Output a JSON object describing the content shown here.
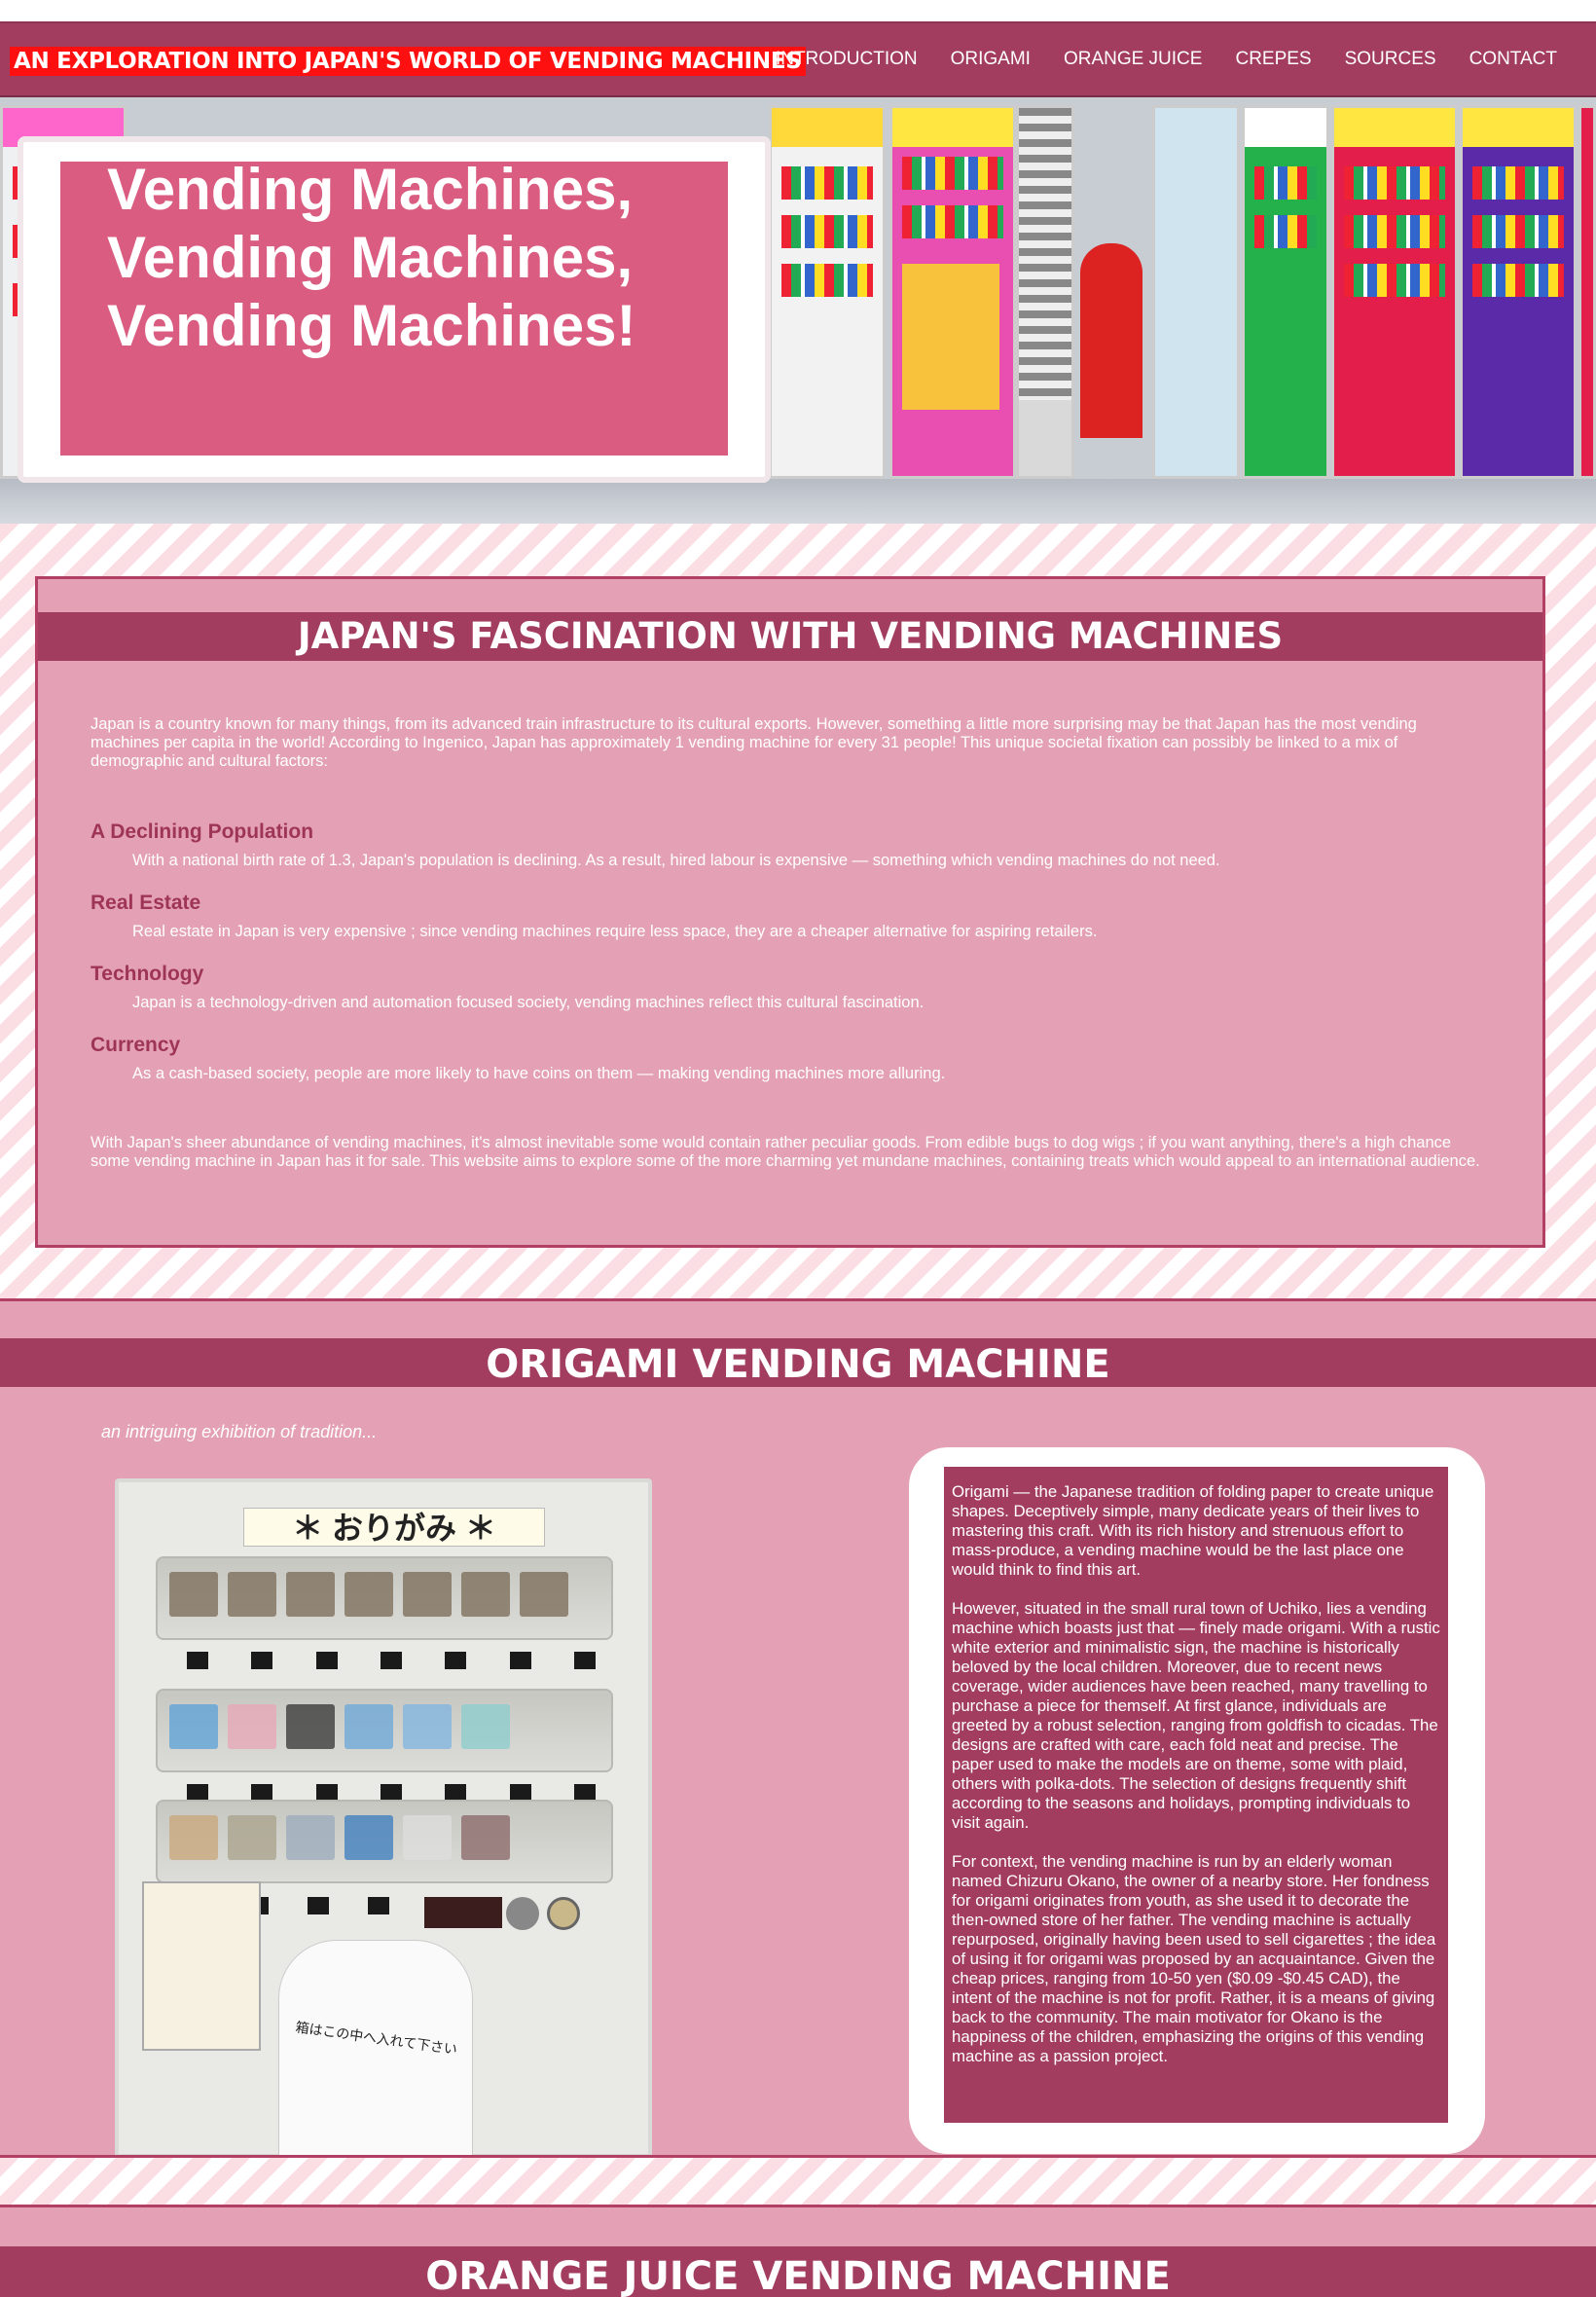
{
  "header": {
    "site_title": "AN EXPLORATION INTO JAPAN'S WORLD OF VENDING MACHINES",
    "nav": [
      "INTRODUCTION",
      "ORIGAMI",
      "ORANGE JUICE",
      "CREPES",
      "SOURCES",
      "CONTACT"
    ]
  },
  "hero": {
    "heading_lines": [
      "Vending Machines,",
      "Vending Machines,",
      "Vending Machines!"
    ]
  },
  "intro": {
    "title": "JAPAN'S FASCINATION WITH VENDING MACHINES",
    "paragraph1": "Japan is a country known for many things, from its advanced train infrastructure to its cultural exports. However, something a little more surprising may be that Japan has the most vending machines per capita in the world! According to Ingenico, Japan has approximately 1 vending machine for every 31 people! This unique societal fixation can possibly be linked to a mix of demographic and cultural factors:",
    "factors": [
      {
        "heading": "A Declining Population",
        "text": "With a national birth rate of 1.3, Japan's population is declining. As a result, hired labour is expensive — something which vending machines do not need."
      },
      {
        "heading": "Real Estate",
        "text": "Real estate in Japan is very expensive ; since vending machines require less space, they are a cheaper alternative for aspiring retailers."
      },
      {
        "heading": "Technology",
        "text": "Japan is a technology-driven and automation focused society, vending machines reflect this cultural fascination."
      },
      {
        "heading": "Currency",
        "text": "As a cash-based society, people are more likely to have coins on them — making vending machines more alluring."
      }
    ],
    "paragraph2": "With Japan's sheer abundance of vending machines, it's almost inevitable some would contain rather peculiar goods. From edible bugs to dog wigs ; if you want anything, there's a high chance some vending machine in Japan has it for sale. This website aims to explore some of the more charming yet mundane machines, containing treats which would appeal to an international audience."
  },
  "origami": {
    "title": "ORIGAMI VENDING MACHINE",
    "caption": "an intriguing exhibition of tradition...",
    "machine_label": "＊ おりがみ ＊",
    "bag_text": "箱はこの中へ入れて下さい",
    "paragraphs": [
      "Origami — the Japanese tradition of folding paper to create unique shapes. Deceptively simple, many dedicate years of their lives to mastering this craft. With its rich history and strenuous effort to mass-produce, a vending machine would be the last place one would think to find this art.",
      "However, situated in the small rural town of Uchiko, lies a vending machine which boasts just that — finely made origami. With a rustic white exterior and minimalistic sign, the machine is historically beloved by the local children. Moreover, due to recent news coverage, wider audiences have been reached, many travelling to purchase a piece for themself. At first glance, individuals are greeted by a robust selection, ranging from goldfish to cicadas. The designs are crafted with care, each fold neat and precise. The paper used to make the models are on theme, some with plaid, others with polka-dots. The selection of designs frequently shift according to the seasons and holidays, prompting individuals to visit again.",
      "For context, the vending machine is run by an elderly woman named Chizuru Okano, the owner of a nearby store. Her fondness for origami originates from youth, as she used it to decorate the then-owned store of her father. The vending machine is actually repurposed, originally having been used to sell cigarettes ; the idea of using it for origami was proposed by an acquaintance. Given the cheap prices, ranging from 10-50 yen ($0.09 -$0.45 CAD), the intent of the machine is not for profit. Rather, it is a means of giving back to the community. The main motivator for Okano is the happiness of the children, emphasizing the origins of this vending machine as a passion project."
    ]
  },
  "orange_juice": {
    "title": "ORANGE JUICE VENDING MACHINE"
  },
  "colors": {
    "nav_bg": "#a33d60",
    "title_highlight": "#ff1010",
    "hero_card": "#da5c80",
    "section_pink": "#e4a1b5",
    "factor_heading": "#9e3558"
  }
}
